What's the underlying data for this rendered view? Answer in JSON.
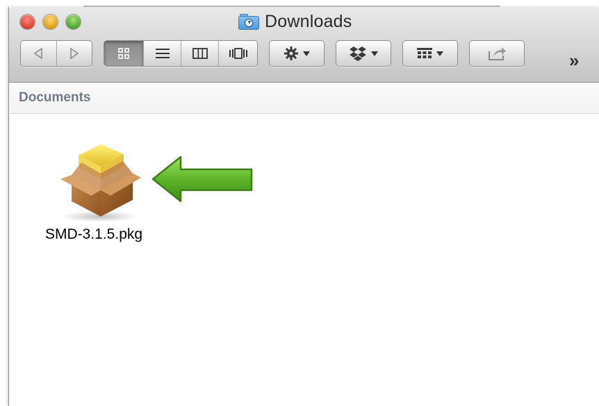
{
  "window": {
    "title": "Downloads",
    "title_icon": "downloads-folder-icon",
    "traffic_lights": {
      "close_color": "#e0463a",
      "minimize_color": "#e5a625",
      "zoom_color": "#5db33b"
    }
  },
  "toolbar": {
    "nav": {
      "back_icon": "back-arrow-icon",
      "forward_icon": "forward-arrow-icon"
    },
    "view_modes": [
      {
        "id": "icon",
        "icon": "icon-view-icon",
        "active": true
      },
      {
        "id": "list",
        "icon": "list-view-icon",
        "active": false
      },
      {
        "id": "column",
        "icon": "column-view-icon",
        "active": false
      },
      {
        "id": "coverflow",
        "icon": "cover-flow-icon",
        "active": false
      }
    ],
    "action_icon": "gear-icon",
    "dropbox_icon": "dropbox-icon",
    "arrange_icon": "arrange-grid-icon",
    "share_icon": "share-icon",
    "overflow_label": "»"
  },
  "pathbar": {
    "label": "Documents"
  },
  "files": [
    {
      "name": "SMD-3.1.5.pkg",
      "icon": "package-box-icon"
    }
  ],
  "annotation": {
    "arrow_icon": "green-left-arrow-icon",
    "color": "#5aa832"
  }
}
